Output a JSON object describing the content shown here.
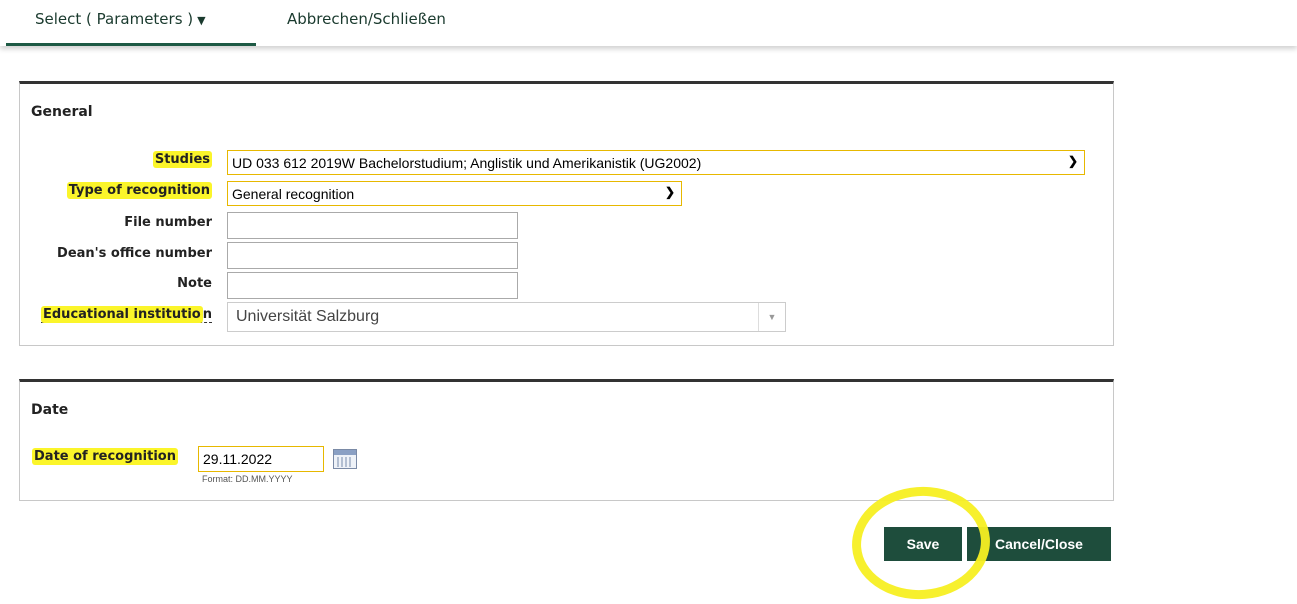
{
  "tabs": {
    "select_label": "Select ( Parameters )",
    "select_caret": "▼",
    "cancel_label": "Abbrechen/Schließen"
  },
  "general": {
    "title": "General",
    "studies_label": "Studies",
    "studies_value": "UD 033 612 2019W Bachelorstudium; Anglistik und Amerikanistik (UG2002)",
    "type_label": "Type of recognition",
    "type_value": "General recognition",
    "file_number_label": "File number",
    "file_number_value": "",
    "dean_label": "Dean's office number",
    "dean_value": "",
    "note_label": "Note",
    "note_value": "",
    "institution_label_part1": "Educational institutio",
    "institution_label_part2": "n",
    "institution_value": "Universität Salzburg"
  },
  "date": {
    "title": "Date",
    "recognition_label": "Date of recognition",
    "recognition_value": "29.11.2022",
    "format_hint": "Format: DD.MM.YYYY"
  },
  "buttons": {
    "save": "Save",
    "cancel": "Cancel/Close"
  },
  "colors": {
    "accent": "#1e4d3c",
    "highlight": "#fbf52a"
  }
}
